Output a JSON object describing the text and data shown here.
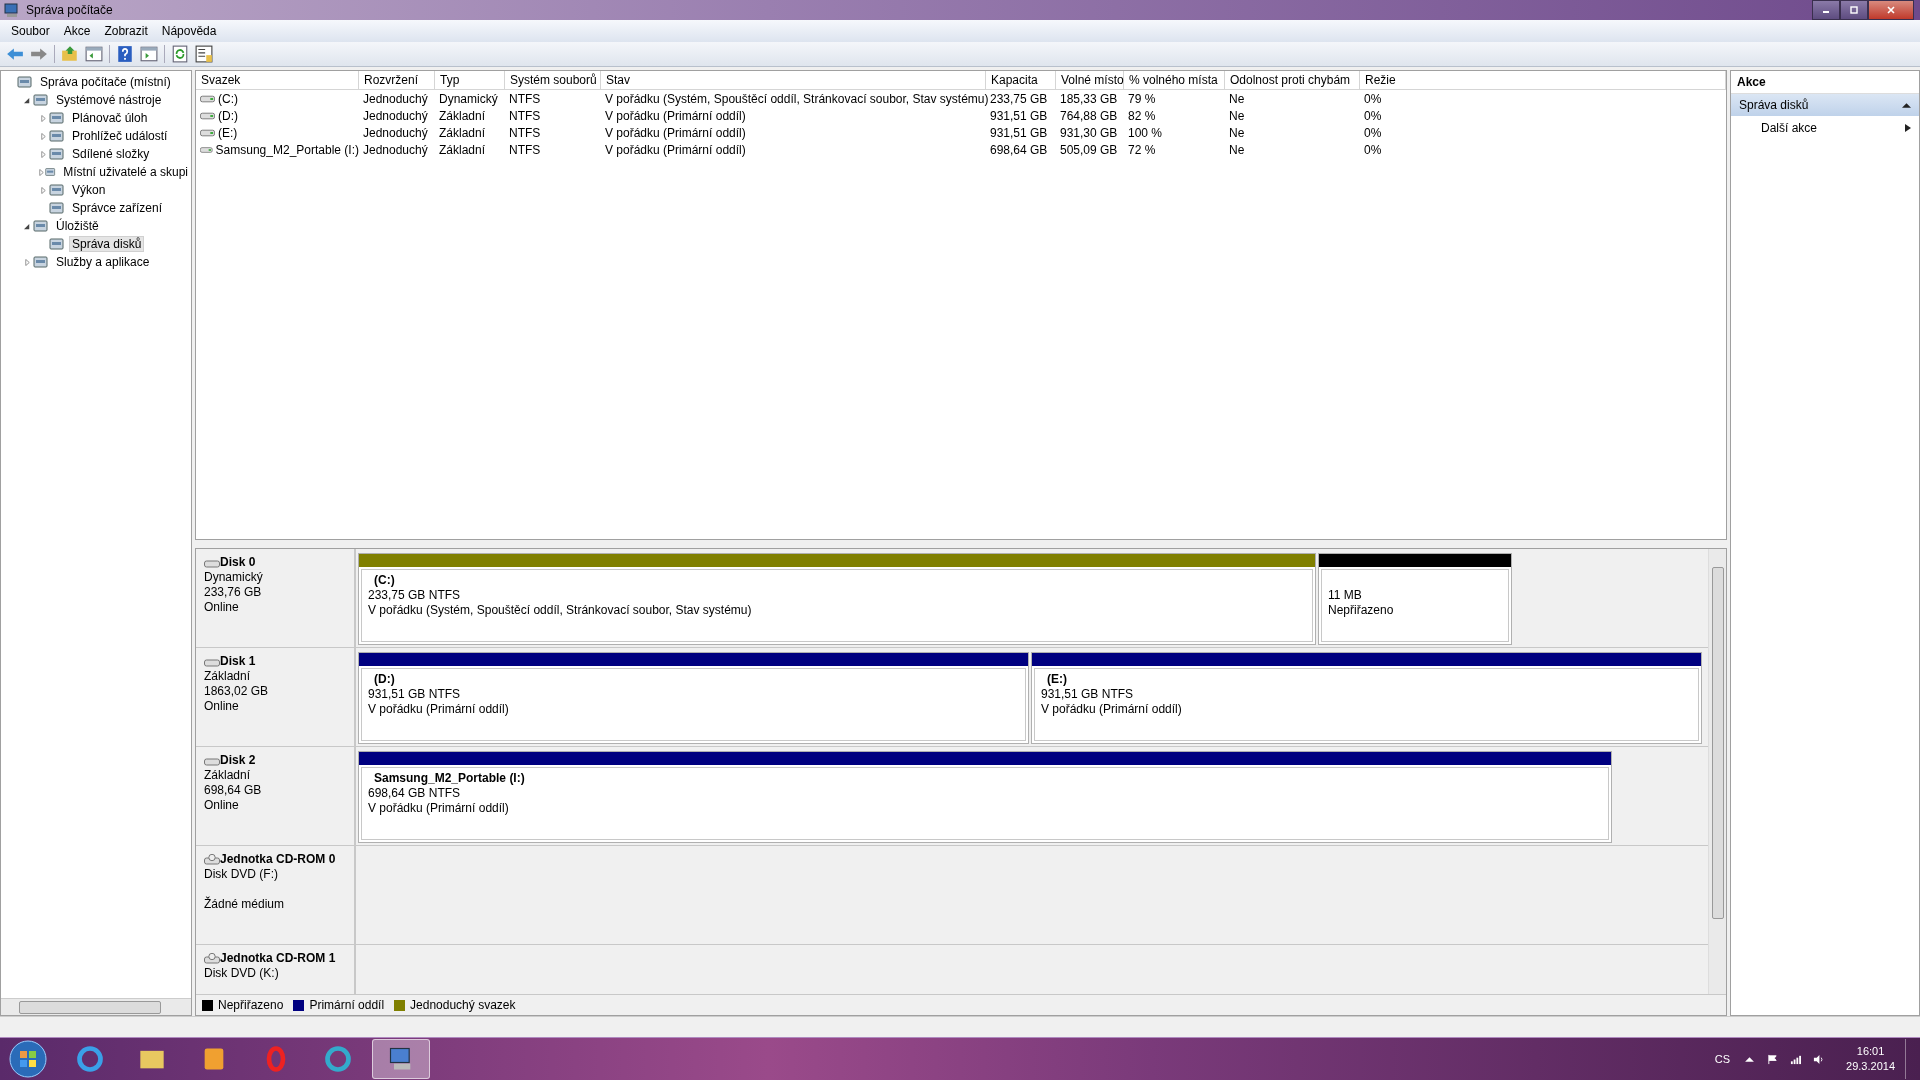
{
  "window": {
    "title": "Správa počítače"
  },
  "menu": [
    "Soubor",
    "Akce",
    "Zobrazit",
    "Nápověda"
  ],
  "tree": [
    {
      "label": "Správa počítače (místní)",
      "selected": false,
      "children": [
        {
          "label": "Systémové nástroje",
          "expanded": true,
          "selected": false,
          "children": [
            {
              "label": "Plánovač úloh",
              "expanded": false,
              "selected": false
            },
            {
              "label": "Prohlížeč událostí",
              "expanded": false,
              "selected": false
            },
            {
              "label": "Sdílené složky",
              "expanded": false,
              "selected": false
            },
            {
              "label": "Místní uživatelé a skupi",
              "expanded": false,
              "selected": false
            },
            {
              "label": "Výkon",
              "expanded": false,
              "selected": false
            },
            {
              "label": "Správce zařízení",
              "selected": false
            }
          ]
        },
        {
          "label": "Úložiště",
          "expanded": true,
          "selected": false,
          "children": [
            {
              "label": "Správa disků",
              "selected": true
            }
          ]
        },
        {
          "label": "Služby a aplikace",
          "expanded": false,
          "selected": false
        }
      ]
    }
  ],
  "table": {
    "columns": [
      "Svazek",
      "Rozvržení",
      "Typ",
      "Systém souborů",
      "Stav",
      "Kapacita",
      "Volné místo",
      "% volného místa",
      "Odolnost proti chybám",
      "Režie"
    ],
    "rows": [
      [
        "(C:)",
        "Jednoduchý",
        "Dynamický",
        "NTFS",
        "V pořádku (Systém, Spouštěcí oddíl, Stránkovací soubor, Stav systému)",
        "233,75 GB",
        "185,33 GB",
        "79 %",
        "Ne",
        "0%"
      ],
      [
        "(D:)",
        "Jednoduchý",
        "Základní",
        "NTFS",
        "V pořádku (Primární oddíl)",
        "931,51 GB",
        "764,88 GB",
        "82 %",
        "Ne",
        "0%"
      ],
      [
        "(E:)",
        "Jednoduchý",
        "Základní",
        "NTFS",
        "V pořádku (Primární oddíl)",
        "931,51 GB",
        "931,30 GB",
        "100 %",
        "Ne",
        "0%"
      ],
      [
        "Samsung_M2_Portable (I:)",
        "Jednoduchý",
        "Základní",
        "NTFS",
        "V pořádku (Primární oddíl)",
        "698,64 GB",
        "505,09 GB",
        "72 %",
        "Ne",
        "0%"
      ]
    ]
  },
  "disks": [
    {
      "kind": "disk",
      "title": "Disk 0",
      "lines": [
        "Dynamický",
        "233,76 GB"
      ],
      "status": "Online",
      "partitions": [
        {
          "kind": "simple",
          "name": "(C:)",
          "size": "233,75 GB NTFS",
          "state": "V pořádku (Systém, Spouštěcí oddíl, Stránkovací soubor, Stav systému)"
        },
        {
          "kind": "unallocated",
          "size": "11 MB",
          "state": "Nepřiřazeno"
        }
      ]
    },
    {
      "kind": "disk",
      "title": "Disk 1",
      "lines": [
        "Základní",
        "1863,02 GB"
      ],
      "status": "Online",
      "partitions": [
        {
          "kind": "primary",
          "name": "(D:)",
          "size": "931,51 GB NTFS",
          "state": "V pořádku (Primární oddíl)"
        },
        {
          "kind": "primary",
          "name": "(E:)",
          "size": "931,51 GB NTFS",
          "state": "V pořádku (Primární oddíl)"
        }
      ]
    },
    {
      "kind": "disk",
      "title": "Disk 2",
      "lines": [
        "Základní",
        "698,64 GB"
      ],
      "status": "Online",
      "partitions": [
        {
          "kind": "primary",
          "name": "Samsung_M2_Portable  (I:)",
          "size": "698,64 GB NTFS",
          "state": "V pořádku (Primární oddíl)"
        }
      ]
    },
    {
      "kind": "cdrom",
      "title": "Jednotka CD-ROM 0",
      "lines": [
        "Disk DVD (F:)"
      ],
      "status": "Žádné médium"
    },
    {
      "kind": "cdrom",
      "title": "Jednotka CD-ROM 1",
      "lines": [
        "Disk DVD (K:)"
      ]
    }
  ],
  "legend": [
    {
      "label": "Nepřiřazeno",
      "color": "#000000"
    },
    {
      "label": "Primární oddíl",
      "color": "#000080"
    },
    {
      "label": "Jednoduchý svazek",
      "color": "#808000"
    }
  ],
  "actions": {
    "title": "Akce",
    "section": {
      "label": "Správa disků",
      "expanded": true
    },
    "items": [
      "Další akce"
    ]
  },
  "taskbar": {
    "apps": [
      {
        "selected": false
      },
      {
        "selected": false
      },
      {
        "selected": false
      },
      {
        "selected": false
      },
      {
        "selected": false
      },
      {
        "selected": true
      }
    ],
    "language": "CS",
    "time": "16:01",
    "date": "29.3.2014"
  }
}
